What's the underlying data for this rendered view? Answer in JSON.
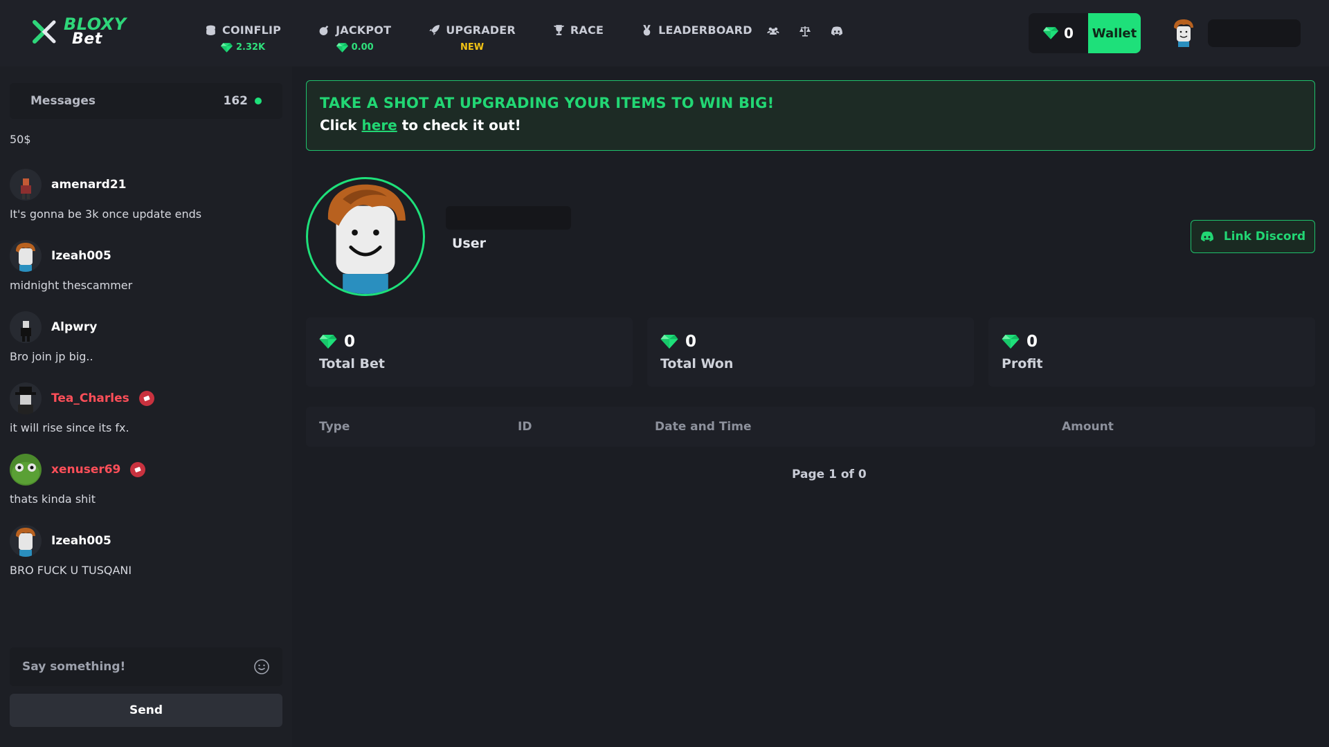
{
  "brand": {
    "line1": "BLOXY",
    "line2": "Bet"
  },
  "nav": [
    {
      "label": "COINFLIP",
      "icon": "coins-icon",
      "sub": "2.32K",
      "sub_type": "gem"
    },
    {
      "label": "JACKPOT",
      "icon": "bomb-icon",
      "sub": "0.00",
      "sub_type": "gem"
    },
    {
      "label": "UPGRADER",
      "icon": "rocket-icon",
      "sub": "NEW",
      "sub_type": "new"
    },
    {
      "label": "RACE",
      "icon": "trophy-icon",
      "sub": "",
      "sub_type": ""
    },
    {
      "label": "LEADERBOARD",
      "icon": "medal-icon",
      "sub": "",
      "sub_type": ""
    }
  ],
  "nav_icons": [
    "users-icon",
    "scale-icon",
    "discord-icon"
  ],
  "wallet": {
    "balance": "0",
    "button": "Wallet"
  },
  "chat": {
    "title": "Messages",
    "count": "162",
    "first_line": "50$",
    "messages": [
      {
        "user": "amenard21",
        "text": "It's gonna be 3k once update ends",
        "staff": false
      },
      {
        "user": "Izeah005",
        "text": "midnight thescammer",
        "staff": false
      },
      {
        "user": "Alpwry",
        "text": "Bro join jp big..",
        "staff": false
      },
      {
        "user": "Tea_Charles",
        "text": "it will rise since its fx.",
        "staff": true
      },
      {
        "user": "xenuser69",
        "text": "thats kinda shit",
        "staff": true
      },
      {
        "user": "Izeah005",
        "text": "BRO FUCK U TUSQANI",
        "staff": false
      }
    ],
    "input_placeholder": "Say something!",
    "send": "Send"
  },
  "banner": {
    "title": "TAKE A SHOT AT UPGRADING YOUR ITEMS TO WIN BIG!",
    "pre": "Click ",
    "link": "here",
    "post": " to check it out!"
  },
  "profile": {
    "role": "User",
    "discord_button": "Link Discord"
  },
  "stats": [
    {
      "value": "0",
      "label": "Total Bet"
    },
    {
      "value": "0",
      "label": "Total Won"
    },
    {
      "value": "0",
      "label": "Profit"
    }
  ],
  "table": {
    "columns": [
      "Type",
      "ID",
      "Date and Time",
      "Amount"
    ],
    "pager": "Page 1 of 0"
  },
  "colors": {
    "accent": "#1ee07a",
    "staff": "#ff4f59",
    "new_badge": "#f2c314",
    "background": "#1b1d23"
  }
}
